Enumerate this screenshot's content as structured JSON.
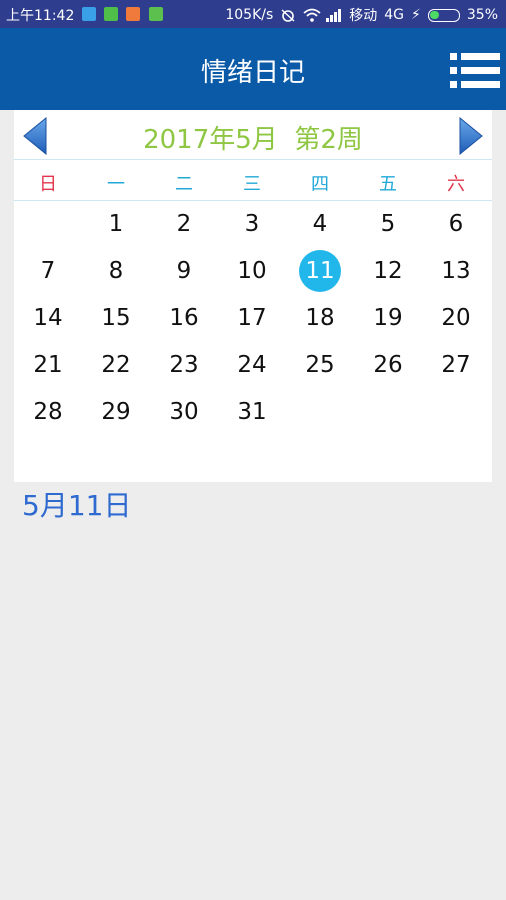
{
  "status_bar": {
    "time": "上午11:42",
    "speed": "105K/s",
    "carrier": "移动",
    "network": "4G",
    "battery": "35%",
    "battery_level": 0.35
  },
  "app_bar": {
    "title": "情绪日记",
    "menu_icon": "menu-list-icon"
  },
  "calendar": {
    "title": "2017年5月  第2周",
    "weekdays": [
      "日",
      "一",
      "二",
      "三",
      "四",
      "五",
      "六"
    ],
    "weekday_colors": [
      "#e2364c",
      "#22a8d8",
      "#22a8d8",
      "#22a8d8",
      "#22a8d8",
      "#22a8d8",
      "#e2364c"
    ],
    "weeks": [
      [
        "",
        "1",
        "2",
        "3",
        "4",
        "5",
        "6"
      ],
      [
        "7",
        "8",
        "9",
        "10",
        "11",
        "12",
        "13"
      ],
      [
        "14",
        "15",
        "16",
        "17",
        "18",
        "19",
        "20"
      ],
      [
        "21",
        "22",
        "23",
        "24",
        "25",
        "26",
        "27"
      ],
      [
        "28",
        "29",
        "30",
        "31",
        "",
        "",
        ""
      ]
    ],
    "selected_day": "11",
    "accent_color": "#22b7ea"
  },
  "selected_date_label": "5月11日"
}
